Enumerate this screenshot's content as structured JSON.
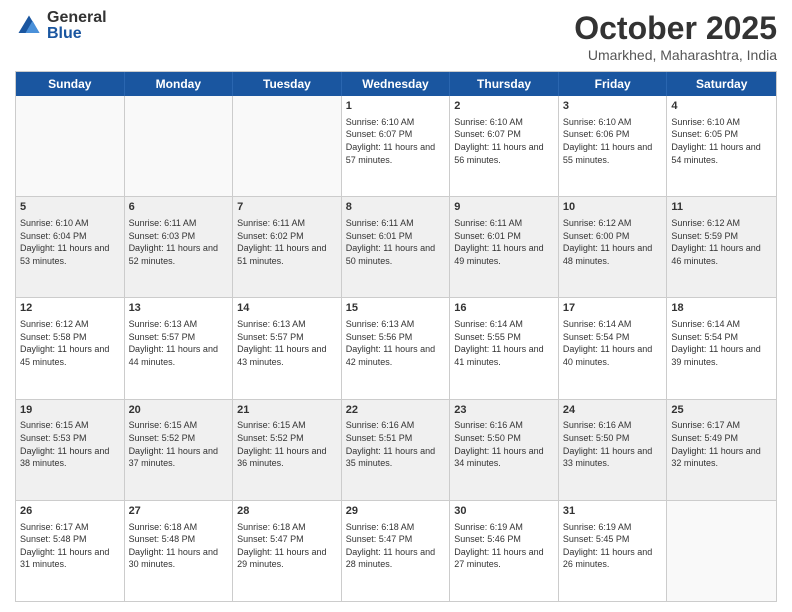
{
  "logo": {
    "general": "General",
    "blue": "Blue"
  },
  "title": "October 2025",
  "location": "Umarkhed, Maharashtra, India",
  "weekdays": [
    "Sunday",
    "Monday",
    "Tuesday",
    "Wednesday",
    "Thursday",
    "Friday",
    "Saturday"
  ],
  "rows": [
    [
      {
        "day": "",
        "info": "",
        "empty": true
      },
      {
        "day": "",
        "info": "",
        "empty": true
      },
      {
        "day": "",
        "info": "",
        "empty": true
      },
      {
        "day": "1",
        "info": "Sunrise: 6:10 AM\nSunset: 6:07 PM\nDaylight: 11 hours and 57 minutes.",
        "shaded": false
      },
      {
        "day": "2",
        "info": "Sunrise: 6:10 AM\nSunset: 6:07 PM\nDaylight: 11 hours and 56 minutes.",
        "shaded": false
      },
      {
        "day": "3",
        "info": "Sunrise: 6:10 AM\nSunset: 6:06 PM\nDaylight: 11 hours and 55 minutes.",
        "shaded": false
      },
      {
        "day": "4",
        "info": "Sunrise: 6:10 AM\nSunset: 6:05 PM\nDaylight: 11 hours and 54 minutes.",
        "shaded": false
      }
    ],
    [
      {
        "day": "5",
        "info": "Sunrise: 6:10 AM\nSunset: 6:04 PM\nDaylight: 11 hours and 53 minutes.",
        "shaded": true
      },
      {
        "day": "6",
        "info": "Sunrise: 6:11 AM\nSunset: 6:03 PM\nDaylight: 11 hours and 52 minutes.",
        "shaded": true
      },
      {
        "day": "7",
        "info": "Sunrise: 6:11 AM\nSunset: 6:02 PM\nDaylight: 11 hours and 51 minutes.",
        "shaded": true
      },
      {
        "day": "8",
        "info": "Sunrise: 6:11 AM\nSunset: 6:01 PM\nDaylight: 11 hours and 50 minutes.",
        "shaded": true
      },
      {
        "day": "9",
        "info": "Sunrise: 6:11 AM\nSunset: 6:01 PM\nDaylight: 11 hours and 49 minutes.",
        "shaded": true
      },
      {
        "day": "10",
        "info": "Sunrise: 6:12 AM\nSunset: 6:00 PM\nDaylight: 11 hours and 48 minutes.",
        "shaded": true
      },
      {
        "day": "11",
        "info": "Sunrise: 6:12 AM\nSunset: 5:59 PM\nDaylight: 11 hours and 46 minutes.",
        "shaded": true
      }
    ],
    [
      {
        "day": "12",
        "info": "Sunrise: 6:12 AM\nSunset: 5:58 PM\nDaylight: 11 hours and 45 minutes.",
        "shaded": false
      },
      {
        "day": "13",
        "info": "Sunrise: 6:13 AM\nSunset: 5:57 PM\nDaylight: 11 hours and 44 minutes.",
        "shaded": false
      },
      {
        "day": "14",
        "info": "Sunrise: 6:13 AM\nSunset: 5:57 PM\nDaylight: 11 hours and 43 minutes.",
        "shaded": false
      },
      {
        "day": "15",
        "info": "Sunrise: 6:13 AM\nSunset: 5:56 PM\nDaylight: 11 hours and 42 minutes.",
        "shaded": false
      },
      {
        "day": "16",
        "info": "Sunrise: 6:14 AM\nSunset: 5:55 PM\nDaylight: 11 hours and 41 minutes.",
        "shaded": false
      },
      {
        "day": "17",
        "info": "Sunrise: 6:14 AM\nSunset: 5:54 PM\nDaylight: 11 hours and 40 minutes.",
        "shaded": false
      },
      {
        "day": "18",
        "info": "Sunrise: 6:14 AM\nSunset: 5:54 PM\nDaylight: 11 hours and 39 minutes.",
        "shaded": false
      }
    ],
    [
      {
        "day": "19",
        "info": "Sunrise: 6:15 AM\nSunset: 5:53 PM\nDaylight: 11 hours and 38 minutes.",
        "shaded": true
      },
      {
        "day": "20",
        "info": "Sunrise: 6:15 AM\nSunset: 5:52 PM\nDaylight: 11 hours and 37 minutes.",
        "shaded": true
      },
      {
        "day": "21",
        "info": "Sunrise: 6:15 AM\nSunset: 5:52 PM\nDaylight: 11 hours and 36 minutes.",
        "shaded": true
      },
      {
        "day": "22",
        "info": "Sunrise: 6:16 AM\nSunset: 5:51 PM\nDaylight: 11 hours and 35 minutes.",
        "shaded": true
      },
      {
        "day": "23",
        "info": "Sunrise: 6:16 AM\nSunset: 5:50 PM\nDaylight: 11 hours and 34 minutes.",
        "shaded": true
      },
      {
        "day": "24",
        "info": "Sunrise: 6:16 AM\nSunset: 5:50 PM\nDaylight: 11 hours and 33 minutes.",
        "shaded": true
      },
      {
        "day": "25",
        "info": "Sunrise: 6:17 AM\nSunset: 5:49 PM\nDaylight: 11 hours and 32 minutes.",
        "shaded": true
      }
    ],
    [
      {
        "day": "26",
        "info": "Sunrise: 6:17 AM\nSunset: 5:48 PM\nDaylight: 11 hours and 31 minutes.",
        "shaded": false
      },
      {
        "day": "27",
        "info": "Sunrise: 6:18 AM\nSunset: 5:48 PM\nDaylight: 11 hours and 30 minutes.",
        "shaded": false
      },
      {
        "day": "28",
        "info": "Sunrise: 6:18 AM\nSunset: 5:47 PM\nDaylight: 11 hours and 29 minutes.",
        "shaded": false
      },
      {
        "day": "29",
        "info": "Sunrise: 6:18 AM\nSunset: 5:47 PM\nDaylight: 11 hours and 28 minutes.",
        "shaded": false
      },
      {
        "day": "30",
        "info": "Sunrise: 6:19 AM\nSunset: 5:46 PM\nDaylight: 11 hours and 27 minutes.",
        "shaded": false
      },
      {
        "day": "31",
        "info": "Sunrise: 6:19 AM\nSunset: 5:45 PM\nDaylight: 11 hours and 26 minutes.",
        "shaded": false
      },
      {
        "day": "",
        "info": "",
        "empty": true
      }
    ]
  ]
}
